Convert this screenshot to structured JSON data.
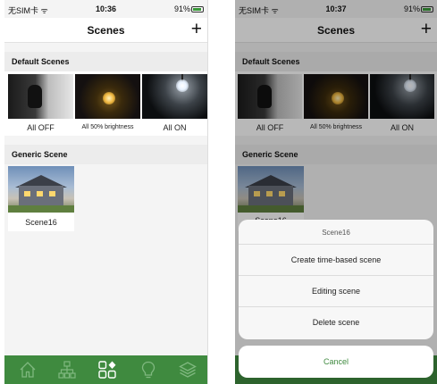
{
  "status_left": {
    "carrier": "无SIM卡 ᯤ",
    "time": "10:36",
    "battery": "91%"
  },
  "status_right": {
    "carrier": "无SIM卡 ᯤ",
    "time": "10:37",
    "battery": "91%"
  },
  "nav": {
    "title": "Scenes",
    "add_label": "+"
  },
  "sections": {
    "default": "Default Scenes",
    "generic": "Generic Scene"
  },
  "default_scenes": [
    {
      "label": "All OFF"
    },
    {
      "label": "All 50% brightness"
    },
    {
      "label": "All ON"
    }
  ],
  "generic_scenes": [
    {
      "label": "Scene16",
      "label_partial": "Scene16"
    }
  ],
  "tab_bar": {
    "color": "#3f8a3f",
    "tabs": [
      {
        "icon": "home-icon",
        "active": false
      },
      {
        "icon": "network-icon",
        "active": false
      },
      {
        "icon": "scenes-icon",
        "active": true
      },
      {
        "icon": "bulb-icon",
        "active": false
      },
      {
        "icon": "layers-icon",
        "active": false
      }
    ]
  },
  "action_sheet": {
    "title": "Scene16",
    "actions": [
      "Create time-based scene",
      "Editing scene",
      "Delete scene"
    ],
    "cancel": "Cancel"
  },
  "colors": {
    "accent": "#3f8a3f",
    "background": "#f4f4f4",
    "section_header": "#ececec"
  }
}
